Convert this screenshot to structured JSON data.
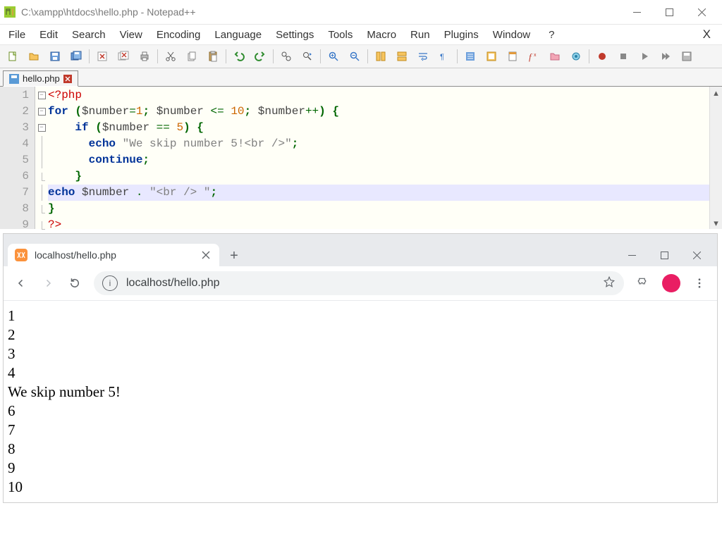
{
  "notepadpp": {
    "title": "C:\\xampp\\htdocs\\hello.php - Notepad++",
    "menus": [
      "File",
      "Edit",
      "Search",
      "View",
      "Encoding",
      "Language",
      "Settings",
      "Tools",
      "Macro",
      "Run",
      "Plugins",
      "Window",
      "?"
    ],
    "tab": {
      "filename": "hello.php"
    },
    "line_numbers": [
      1,
      2,
      3,
      4,
      5,
      6,
      7,
      8,
      9
    ],
    "fold_markers": [
      "box",
      "box",
      "box",
      "line",
      "line",
      "end",
      "line",
      "end",
      "end"
    ],
    "code_lines": [
      [
        {
          "t": "<?php",
          "c": "tag"
        }
      ],
      [
        {
          "t": "for",
          "c": "kw"
        },
        {
          "t": " ",
          "c": ""
        },
        {
          "t": "(",
          "c": "pun"
        },
        {
          "t": "$number",
          "c": "var"
        },
        {
          "t": "=",
          "c": "op"
        },
        {
          "t": "1",
          "c": "num"
        },
        {
          "t": ";",
          "c": "pun"
        },
        {
          "t": " ",
          "c": ""
        },
        {
          "t": "$number",
          "c": "var"
        },
        {
          "t": " <= ",
          "c": "op"
        },
        {
          "t": "10",
          "c": "num"
        },
        {
          "t": ";",
          "c": "pun"
        },
        {
          "t": " ",
          "c": ""
        },
        {
          "t": "$number",
          "c": "var"
        },
        {
          "t": "++",
          "c": "op"
        },
        {
          "t": ")",
          "c": "pun"
        },
        {
          "t": " ",
          "c": ""
        },
        {
          "t": "{",
          "c": "pun"
        }
      ],
      [
        {
          "t": "    ",
          "c": ""
        },
        {
          "t": "if",
          "c": "kw"
        },
        {
          "t": " ",
          "c": ""
        },
        {
          "t": "(",
          "c": "pun"
        },
        {
          "t": "$number",
          "c": "var"
        },
        {
          "t": " == ",
          "c": "op"
        },
        {
          "t": "5",
          "c": "num"
        },
        {
          "t": ")",
          "c": "pun"
        },
        {
          "t": " ",
          "c": ""
        },
        {
          "t": "{",
          "c": "pun"
        }
      ],
      [
        {
          "t": "      ",
          "c": ""
        },
        {
          "t": "echo",
          "c": "kw"
        },
        {
          "t": " ",
          "c": ""
        },
        {
          "t": "\"We skip number 5!<br />\"",
          "c": "str"
        },
        {
          "t": ";",
          "c": "pun"
        }
      ],
      [
        {
          "t": "      ",
          "c": ""
        },
        {
          "t": "continue",
          "c": "kw"
        },
        {
          "t": ";",
          "c": "pun"
        }
      ],
      [
        {
          "t": "    ",
          "c": ""
        },
        {
          "t": "}",
          "c": "pun"
        }
      ],
      [
        {
          "t": "echo",
          "c": "kw"
        },
        {
          "t": " ",
          "c": ""
        },
        {
          "t": "$number",
          "c": "var"
        },
        {
          "t": " ",
          "c": ""
        },
        {
          "t": ".",
          "c": "op"
        },
        {
          "t": " ",
          "c": ""
        },
        {
          "t": "\"<br /> \"",
          "c": "str"
        },
        {
          "t": ";",
          "c": "pun"
        }
      ],
      [
        {
          "t": "}",
          "c": "pun"
        }
      ],
      [
        {
          "t": "?>",
          "c": "tag"
        }
      ]
    ],
    "highlighted_line_index": 6
  },
  "browser": {
    "tab_title": "localhost/hello.php",
    "url": "localhost/hello.php",
    "output_lines": [
      "1",
      "2",
      "3",
      "4",
      "We skip number 5!",
      "6",
      "7",
      "8",
      "9",
      "10"
    ]
  }
}
